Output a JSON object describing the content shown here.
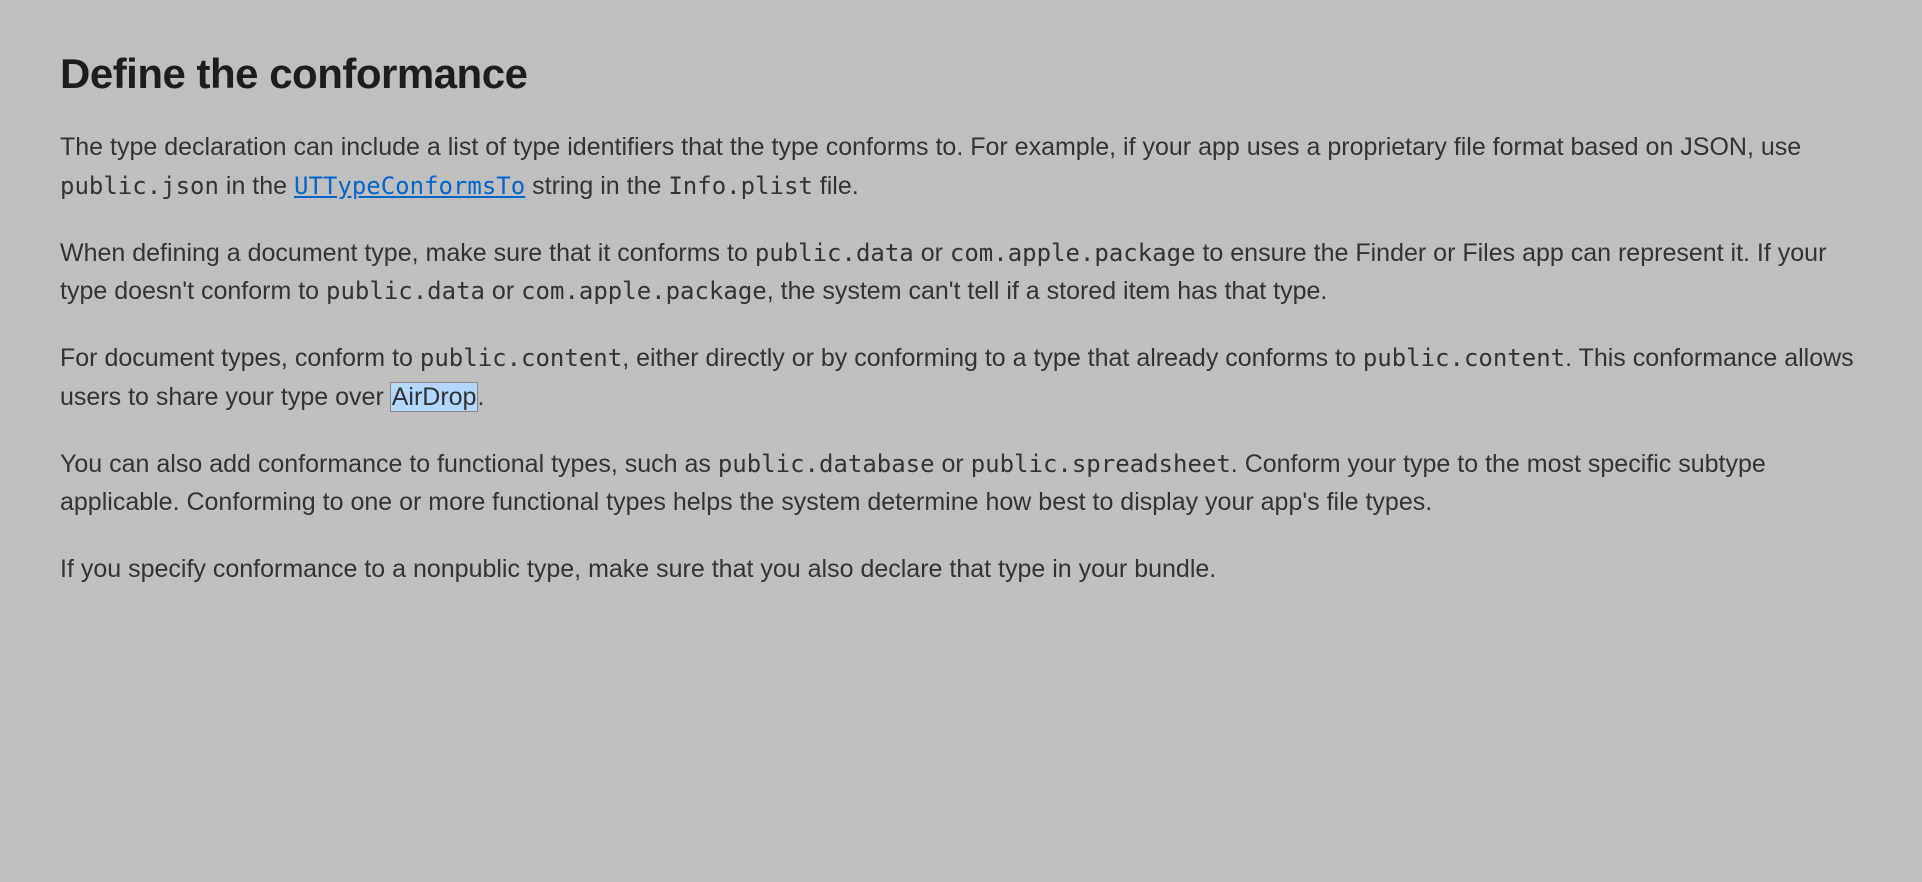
{
  "heading": "Define the conformance",
  "p1": {
    "t1": "The type declaration can include a list of type identifiers that the type conforms to. For example, if your app uses a proprietary file format based on JSON, use ",
    "c1": "public.json",
    "t2": " in the ",
    "link": "UTTypeConformsTo",
    "t3": " string in the ",
    "c2": "Info.plist",
    "t4": " file."
  },
  "p2": {
    "t1": "When defining a document type, make sure that it conforms to ",
    "c1": "public.data",
    "t2": " or ",
    "c2": "com.apple.package",
    "t3": " to ensure the Finder or Files app can represent it. If your type doesn't conform to ",
    "c3": "public.data",
    "t4": " or ",
    "c4": "com.apple.package",
    "t5": ", the system can't tell if a stored item has that type."
  },
  "p3": {
    "t1": "For document types, conform to ",
    "c1": "public.content",
    "t2": ", either directly or by conforming to a type that already conforms to ",
    "c2": "public.content",
    "t3": ". This conformance allows users to share your type over ",
    "hl": "AirDrop",
    "t4": "."
  },
  "p4": {
    "t1": "You can also add conformance to functional types, such as ",
    "c1": "public.database",
    "t2": " or ",
    "c2": "public.spreadsheet",
    "t3": ". Conform your type to the most specific subtype applicable. Conforming to one or more functional types helps the system determine how best to display your app's file types."
  },
  "p5": {
    "t1": "If you specify conformance to a nonpublic type, make sure that you also declare that type in your bundle."
  }
}
